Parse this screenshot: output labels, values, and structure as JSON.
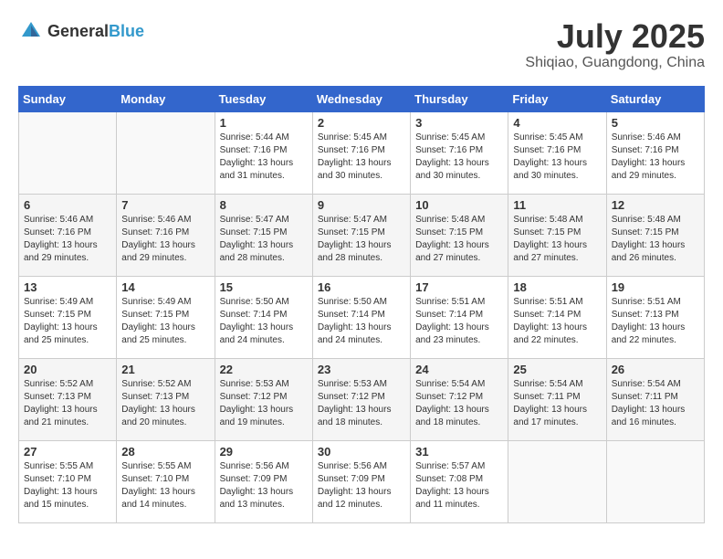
{
  "header": {
    "logo_general": "General",
    "logo_blue": "Blue",
    "month": "July 2025",
    "location": "Shiqiao, Guangdong, China"
  },
  "days_of_week": [
    "Sunday",
    "Monday",
    "Tuesday",
    "Wednesday",
    "Thursday",
    "Friday",
    "Saturday"
  ],
  "weeks": [
    [
      {
        "day": "",
        "info": ""
      },
      {
        "day": "",
        "info": ""
      },
      {
        "day": "1",
        "info": "Sunrise: 5:44 AM\nSunset: 7:16 PM\nDaylight: 13 hours\nand 31 minutes."
      },
      {
        "day": "2",
        "info": "Sunrise: 5:45 AM\nSunset: 7:16 PM\nDaylight: 13 hours\nand 30 minutes."
      },
      {
        "day": "3",
        "info": "Sunrise: 5:45 AM\nSunset: 7:16 PM\nDaylight: 13 hours\nand 30 minutes."
      },
      {
        "day": "4",
        "info": "Sunrise: 5:45 AM\nSunset: 7:16 PM\nDaylight: 13 hours\nand 30 minutes."
      },
      {
        "day": "5",
        "info": "Sunrise: 5:46 AM\nSunset: 7:16 PM\nDaylight: 13 hours\nand 29 minutes."
      }
    ],
    [
      {
        "day": "6",
        "info": "Sunrise: 5:46 AM\nSunset: 7:16 PM\nDaylight: 13 hours\nand 29 minutes."
      },
      {
        "day": "7",
        "info": "Sunrise: 5:46 AM\nSunset: 7:16 PM\nDaylight: 13 hours\nand 29 minutes."
      },
      {
        "day": "8",
        "info": "Sunrise: 5:47 AM\nSunset: 7:15 PM\nDaylight: 13 hours\nand 28 minutes."
      },
      {
        "day": "9",
        "info": "Sunrise: 5:47 AM\nSunset: 7:15 PM\nDaylight: 13 hours\nand 28 minutes."
      },
      {
        "day": "10",
        "info": "Sunrise: 5:48 AM\nSunset: 7:15 PM\nDaylight: 13 hours\nand 27 minutes."
      },
      {
        "day": "11",
        "info": "Sunrise: 5:48 AM\nSunset: 7:15 PM\nDaylight: 13 hours\nand 27 minutes."
      },
      {
        "day": "12",
        "info": "Sunrise: 5:48 AM\nSunset: 7:15 PM\nDaylight: 13 hours\nand 26 minutes."
      }
    ],
    [
      {
        "day": "13",
        "info": "Sunrise: 5:49 AM\nSunset: 7:15 PM\nDaylight: 13 hours\nand 25 minutes."
      },
      {
        "day": "14",
        "info": "Sunrise: 5:49 AM\nSunset: 7:15 PM\nDaylight: 13 hours\nand 25 minutes."
      },
      {
        "day": "15",
        "info": "Sunrise: 5:50 AM\nSunset: 7:14 PM\nDaylight: 13 hours\nand 24 minutes."
      },
      {
        "day": "16",
        "info": "Sunrise: 5:50 AM\nSunset: 7:14 PM\nDaylight: 13 hours\nand 24 minutes."
      },
      {
        "day": "17",
        "info": "Sunrise: 5:51 AM\nSunset: 7:14 PM\nDaylight: 13 hours\nand 23 minutes."
      },
      {
        "day": "18",
        "info": "Sunrise: 5:51 AM\nSunset: 7:14 PM\nDaylight: 13 hours\nand 22 minutes."
      },
      {
        "day": "19",
        "info": "Sunrise: 5:51 AM\nSunset: 7:13 PM\nDaylight: 13 hours\nand 22 minutes."
      }
    ],
    [
      {
        "day": "20",
        "info": "Sunrise: 5:52 AM\nSunset: 7:13 PM\nDaylight: 13 hours\nand 21 minutes."
      },
      {
        "day": "21",
        "info": "Sunrise: 5:52 AM\nSunset: 7:13 PM\nDaylight: 13 hours\nand 20 minutes."
      },
      {
        "day": "22",
        "info": "Sunrise: 5:53 AM\nSunset: 7:12 PM\nDaylight: 13 hours\nand 19 minutes."
      },
      {
        "day": "23",
        "info": "Sunrise: 5:53 AM\nSunset: 7:12 PM\nDaylight: 13 hours\nand 18 minutes."
      },
      {
        "day": "24",
        "info": "Sunrise: 5:54 AM\nSunset: 7:12 PM\nDaylight: 13 hours\nand 18 minutes."
      },
      {
        "day": "25",
        "info": "Sunrise: 5:54 AM\nSunset: 7:11 PM\nDaylight: 13 hours\nand 17 minutes."
      },
      {
        "day": "26",
        "info": "Sunrise: 5:54 AM\nSunset: 7:11 PM\nDaylight: 13 hours\nand 16 minutes."
      }
    ],
    [
      {
        "day": "27",
        "info": "Sunrise: 5:55 AM\nSunset: 7:10 PM\nDaylight: 13 hours\nand 15 minutes."
      },
      {
        "day": "28",
        "info": "Sunrise: 5:55 AM\nSunset: 7:10 PM\nDaylight: 13 hours\nand 14 minutes."
      },
      {
        "day": "29",
        "info": "Sunrise: 5:56 AM\nSunset: 7:09 PM\nDaylight: 13 hours\nand 13 minutes."
      },
      {
        "day": "30",
        "info": "Sunrise: 5:56 AM\nSunset: 7:09 PM\nDaylight: 13 hours\nand 12 minutes."
      },
      {
        "day": "31",
        "info": "Sunrise: 5:57 AM\nSunset: 7:08 PM\nDaylight: 13 hours\nand 11 minutes."
      },
      {
        "day": "",
        "info": ""
      },
      {
        "day": "",
        "info": ""
      }
    ]
  ]
}
